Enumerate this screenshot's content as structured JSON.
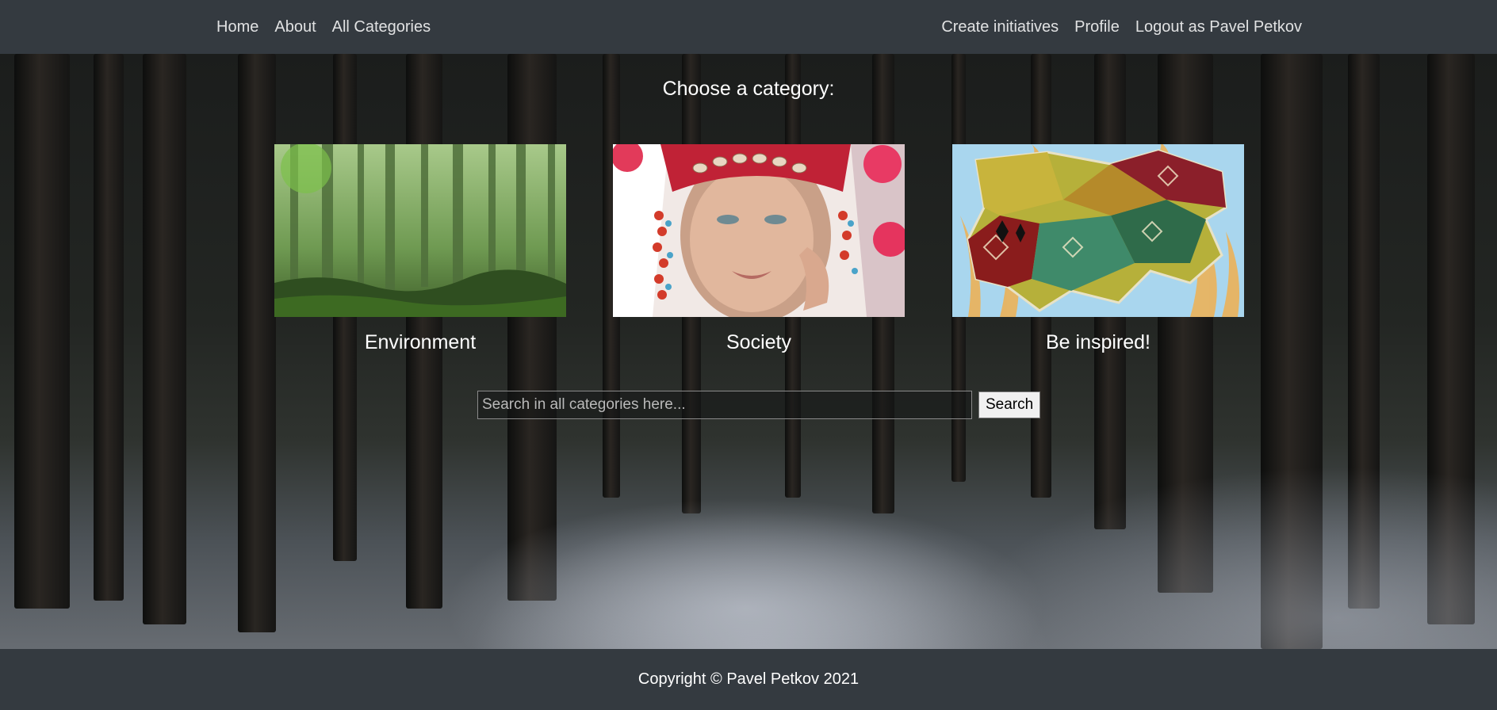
{
  "nav": {
    "left_links": [
      "Home",
      "About",
      "All Categories"
    ],
    "right_links": [
      "Create initiatives",
      "Profile",
      "Logout as Pavel Petkov"
    ]
  },
  "main": {
    "heading": "Choose a category:",
    "categories": [
      {
        "label": "Environment",
        "image": "misty-forest-photo"
      },
      {
        "label": "Society",
        "image": "woman-in-folk-costume-photo"
      },
      {
        "label": "Be inspired!",
        "image": "embroidered-map-illustration"
      }
    ],
    "search": {
      "placeholder": "Search in all categories here...",
      "value": "",
      "button_label": "Search"
    }
  },
  "footer": {
    "copyright": "Copyright © Pavel Petkov 2021"
  },
  "colors": {
    "navbar_bg": "#343a40",
    "footer_bg": "#343a40",
    "text": "#ffffff"
  }
}
